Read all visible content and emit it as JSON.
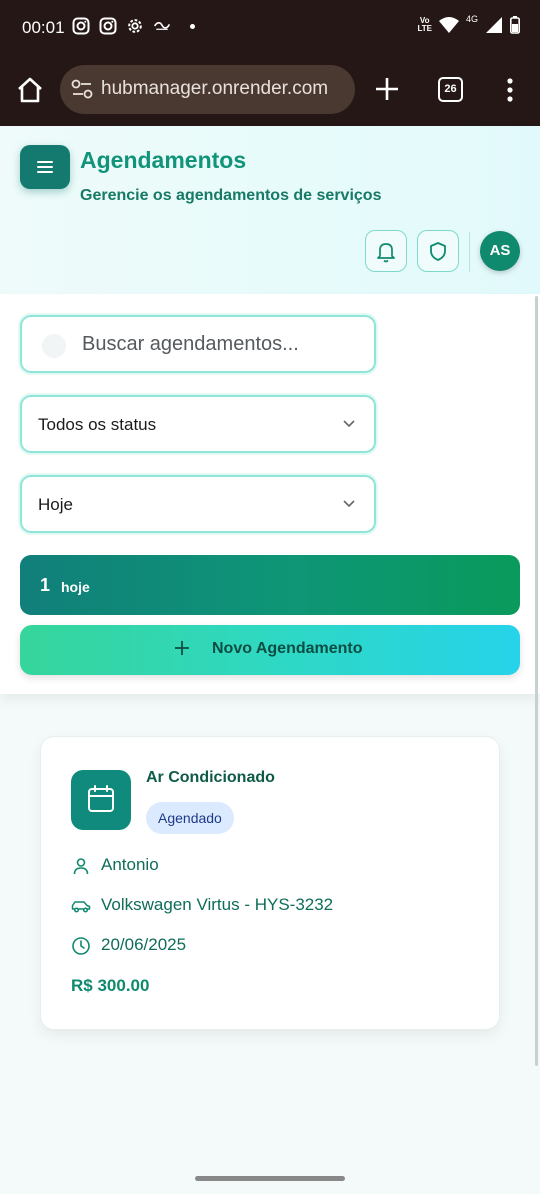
{
  "status_bar": {
    "time": "00:01",
    "network": "4G",
    "volte": "Vo\nLTE"
  },
  "browser": {
    "url": "hubmanager.onrender.com",
    "tab_count": "26"
  },
  "header": {
    "title": "Agendamentos",
    "subtitle": "Gerencie os agendamentos de serviços",
    "avatar_initials": "AS"
  },
  "filters": {
    "search_placeholder": "Buscar agendamentos...",
    "status_selected": "Todos os status",
    "date_selected": "Hoje",
    "count_value": "1",
    "count_label": "hoje",
    "new_button_label": "Novo Agendamento"
  },
  "appointments": [
    {
      "service": "Ar Condicionado",
      "status": "Agendado",
      "client": "Antonio",
      "vehicle": "Volkswagen Virtus - HYS-3232",
      "date": "20/06/2025",
      "price": "R$ 300.00"
    }
  ],
  "colors": {
    "primary": "#0f8a6e",
    "accent_teal": "#147a70",
    "badge_bg": "#dbeafe",
    "badge_text": "#1e3a8a"
  },
  "icons": [
    "menu-icon",
    "bell-icon",
    "shield-icon",
    "search-icon",
    "chevron-down-icon",
    "plus-icon",
    "calendar-icon",
    "user-icon",
    "car-icon",
    "clock-icon"
  ]
}
